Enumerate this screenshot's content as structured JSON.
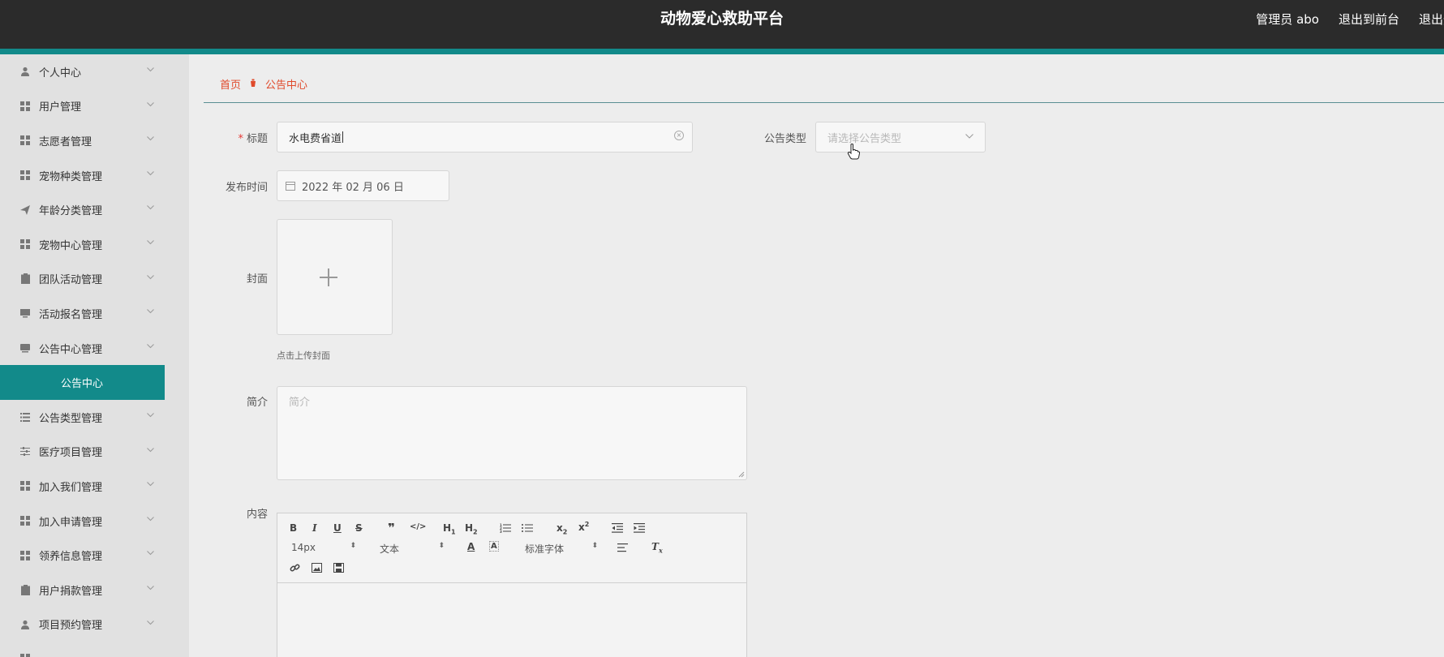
{
  "header": {
    "title": "动物爱心救助平台",
    "user": "管理员 abo",
    "exit_front": "退出到前台",
    "logout": "退出登"
  },
  "sidebar": {
    "items": [
      {
        "label": "个人中心",
        "icon": "user-icon"
      },
      {
        "label": "用户管理",
        "icon": "grid-icon"
      },
      {
        "label": "志愿者管理",
        "icon": "grid-icon"
      },
      {
        "label": "宠物种类管理",
        "icon": "grid-icon"
      },
      {
        "label": "年龄分类管理",
        "icon": "send-icon"
      },
      {
        "label": "宠物中心管理",
        "icon": "grid-icon"
      },
      {
        "label": "团队活动管理",
        "icon": "clipboard-icon"
      },
      {
        "label": "活动报名管理",
        "icon": "monitor-icon"
      },
      {
        "label": "公告中心管理",
        "icon": "doc-icon"
      },
      {
        "label": "公告类型管理",
        "icon": "list-icon"
      },
      {
        "label": "医疗项目管理",
        "icon": "sliders-icon"
      },
      {
        "label": "加入我们管理",
        "icon": "grid-icon"
      },
      {
        "label": "加入申请管理",
        "icon": "grid-icon"
      },
      {
        "label": "领养信息管理",
        "icon": "grid-icon"
      },
      {
        "label": "用户捐款管理",
        "icon": "clipboard-icon"
      },
      {
        "label": "项目预约管理",
        "icon": "user-icon"
      }
    ],
    "active_sub": "公告中心"
  },
  "breadcrumb": {
    "home": "首页",
    "current": "公告中心"
  },
  "form": {
    "title_label": "标题",
    "title_value": "水电费省道",
    "type_label": "公告类型",
    "type_placeholder": "请选择公告类型",
    "date_label": "发布时间",
    "date_value": "2022 年 02 月 06 日",
    "cover_label": "封面",
    "cover_hint": "点击上传封面",
    "intro_label": "简介",
    "intro_placeholder": "简介",
    "content_label": "内容"
  },
  "editor": {
    "font_size": "14px",
    "format": "文本",
    "font_family": "标准字体"
  },
  "colors": {
    "accent": "#128a8a",
    "header": "#2b2b2b",
    "breadcrumb": "#e04a2b"
  }
}
